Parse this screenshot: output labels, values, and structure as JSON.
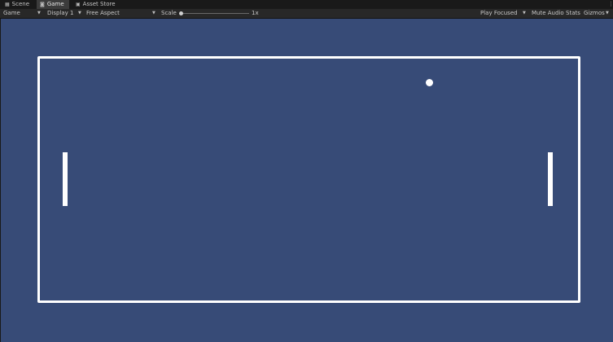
{
  "tabs": [
    {
      "label": "Scene",
      "icon": "grid-icon"
    },
    {
      "label": "Game",
      "icon": "gamepad-icon",
      "active": true
    },
    {
      "label": "Asset Store",
      "icon": "bag-icon"
    }
  ],
  "tab_menu_glyph": "⋮",
  "toolbar": {
    "view_label": "Game",
    "display": "Display 1",
    "aspect": "Free Aspect",
    "scale_label": "Scale",
    "scale_value": "1x",
    "scale_level": 0.0,
    "play_mode": "Play Focused",
    "mute_audio": "Mute Audio",
    "stats": "Stats",
    "gizmos": "Gizmos"
  },
  "game": {
    "background_color": "#374b77",
    "foreground_color": "#ffffff"
  }
}
